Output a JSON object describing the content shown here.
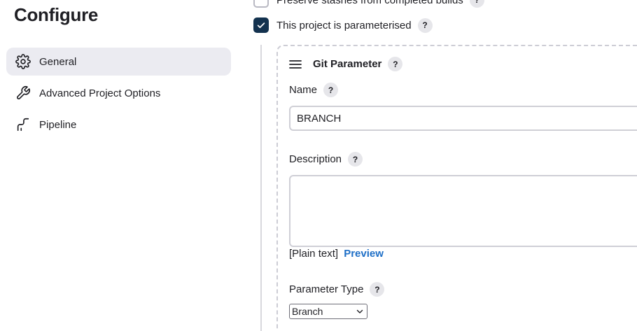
{
  "page": {
    "title": "Configure"
  },
  "sidebar": {
    "items": [
      {
        "label": "General",
        "icon": "gear-icon",
        "active": true
      },
      {
        "label": "Advanced Project Options",
        "icon": "wrench-icon",
        "active": false
      },
      {
        "label": "Pipeline",
        "icon": "pipeline-icon",
        "active": false
      }
    ]
  },
  "options": {
    "preserve_stashes": {
      "label": "Preserve stashes from completed builds",
      "checked": false
    },
    "parameterised": {
      "label": "This project is parameterised",
      "checked": true
    }
  },
  "help_glyph": "?",
  "parameter": {
    "title": "Git Parameter",
    "name_label": "Name",
    "name_value": "BRANCH",
    "description_label": "Description",
    "description_value": "",
    "format_label": "[Plain text]",
    "preview_label": "Preview",
    "type_label": "Parameter Type",
    "type_value": "Branch"
  },
  "colors": {
    "accent_link": "#1e6fc7",
    "checkbox_checked": "#13324f",
    "active_nav_bg": "#ebebf1"
  }
}
